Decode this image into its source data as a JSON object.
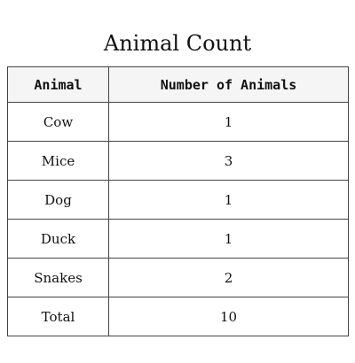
{
  "title": "Animal Count",
  "table": {
    "headers": [
      "Animal",
      "Number of Animals"
    ],
    "rows": [
      [
        "Cow",
        "1"
      ],
      [
        "Mice",
        "3"
      ],
      [
        "Dog",
        "1"
      ],
      [
        "Duck",
        "1"
      ],
      [
        "Snakes",
        "2"
      ],
      [
        "Total",
        "10"
      ]
    ]
  }
}
